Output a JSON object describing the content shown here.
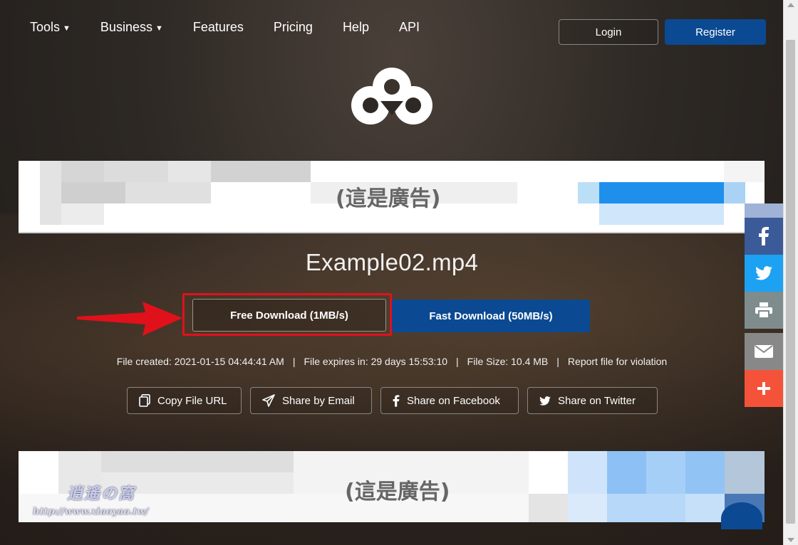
{
  "nav": {
    "items": [
      {
        "label": "Tools",
        "dropdown": true
      },
      {
        "label": "Business",
        "dropdown": true
      },
      {
        "label": "Features",
        "dropdown": false
      },
      {
        "label": "Pricing",
        "dropdown": false
      },
      {
        "label": "Help",
        "dropdown": false
      },
      {
        "label": "API",
        "dropdown": false
      }
    ],
    "login_label": "Login",
    "register_label": "Register"
  },
  "ads": {
    "top_label": "(這是廣告)",
    "bottom_label": "(這是廣告)"
  },
  "file": {
    "name": "Example02.mp4"
  },
  "download": {
    "free_label": "Free Download (1MB/s)",
    "fast_label": "Fast Download (50MB/s)"
  },
  "meta": {
    "created": "File created: 2021-01-15 04:44:41 AM",
    "expires": "File expires in: 29 days 15:53:10",
    "size": "File Size: 10.4 MB",
    "separator": "|",
    "report": "Report file for violation"
  },
  "share": {
    "copy_url": "Copy File URL",
    "email": "Share by Email",
    "facebook": "Share on Facebook",
    "twitter": "Share on Twitter"
  },
  "watermark": {
    "title": "逍遙の窩",
    "url": "http://www.xiaoyao.tw/"
  },
  "colors": {
    "primary_blue": "#0b4a92",
    "highlight_red": "#e0111b",
    "facebook": "#3b5a98",
    "twitter": "#1da1f2",
    "print": "#7f8c8d",
    "email": "#888888",
    "plus": "#f4533a"
  },
  "icons": [
    "logo-icon",
    "copy-icon",
    "paper-plane-icon",
    "facebook-icon",
    "twitter-icon",
    "print-icon",
    "envelope-icon",
    "plus-icon",
    "chevron-down-icon",
    "red-arrow"
  ]
}
